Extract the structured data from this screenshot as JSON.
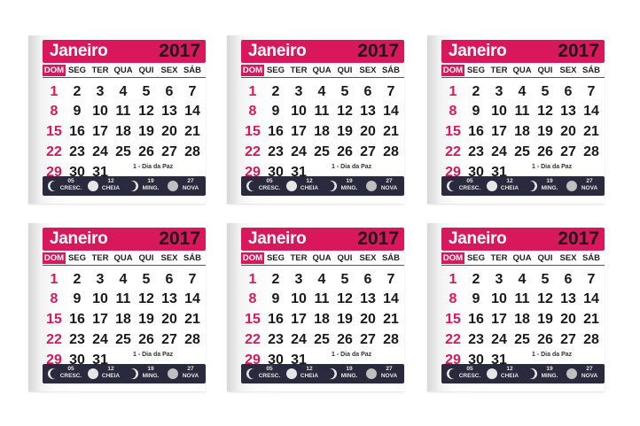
{
  "calendar": {
    "month": "Janeiro",
    "year": "2017",
    "weekdays": [
      "DOM",
      "SEG",
      "TER",
      "QUA",
      "QUI",
      "SEX",
      "SÁB"
    ],
    "weeks": [
      [
        "",
        "",
        "",
        "",
        "",
        "",
        ""
      ],
      [
        "1",
        "2",
        "3",
        "4",
        "5",
        "6",
        "7"
      ],
      [
        "8",
        "9",
        "10",
        "11",
        "12",
        "13",
        "14"
      ],
      [
        "15",
        "16",
        "17",
        "18",
        "19",
        "20",
        "21"
      ],
      [
        "22",
        "23",
        "24",
        "25",
        "26",
        "27",
        "28"
      ],
      [
        "29",
        "30",
        "31",
        "",
        "",
        "",
        ""
      ]
    ],
    "holiday": "1 - Dia da Paz",
    "moon_phases": [
      {
        "day": "05",
        "label": "CRESC."
      },
      {
        "day": "12",
        "label": "CHEIA"
      },
      {
        "day": "19",
        "label": "MING."
      },
      {
        "day": "27",
        "label": "NOVA"
      }
    ],
    "colors": {
      "accent": "#d8185a",
      "band": "#2a2a3e",
      "text": "#1a1a1a"
    }
  },
  "pads": 6
}
